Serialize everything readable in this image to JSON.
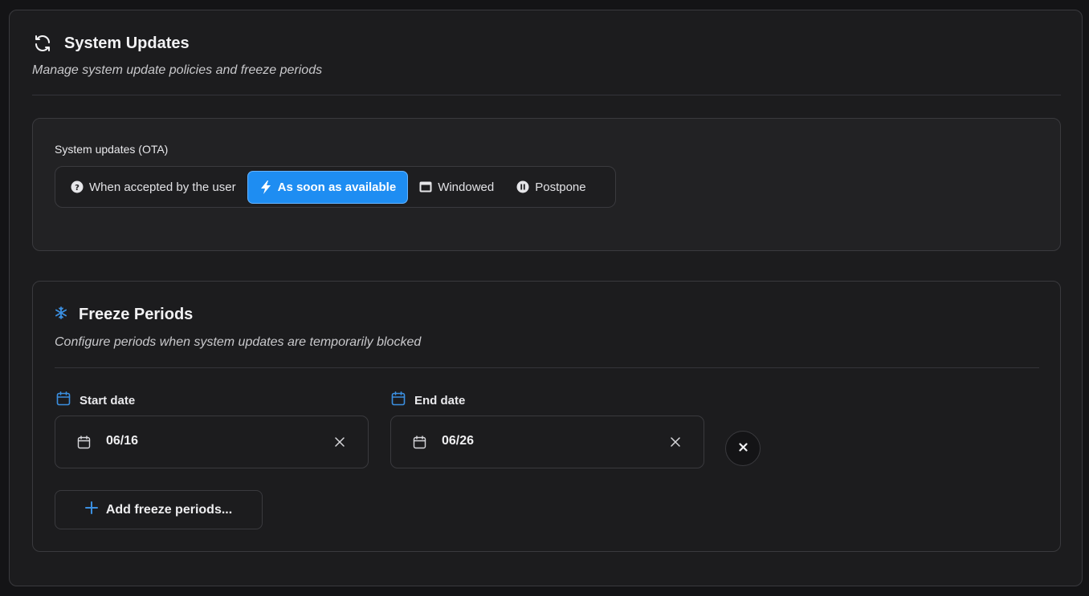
{
  "header": {
    "title": "System Updates",
    "subtitle": "Manage system update policies and freeze periods",
    "icon": "refresh-icon"
  },
  "ota": {
    "label": "System updates (OTA)",
    "options": [
      {
        "label": "When accepted by the user",
        "icon": "question-circle-icon",
        "active": false
      },
      {
        "label": "As soon as available",
        "icon": "lightning-bolt-icon",
        "active": true
      },
      {
        "label": "Windowed",
        "icon": "window-icon",
        "active": false
      },
      {
        "label": "Postpone",
        "icon": "pause-circle-icon",
        "active": false
      }
    ]
  },
  "freeze": {
    "title": "Freeze Periods",
    "subtitle": "Configure periods when system updates are temporarily blocked",
    "icon": "snowflake-icon",
    "start_label": "Start date",
    "end_label": "End date",
    "start_value": "06/16",
    "end_value": "06/26",
    "add_label": "Add freeze periods..."
  },
  "colors": {
    "accent": "#1e8df2",
    "background": "#1c1c1e",
    "border": "#3a3a3e",
    "icon_blue": "#3b8fe0"
  }
}
